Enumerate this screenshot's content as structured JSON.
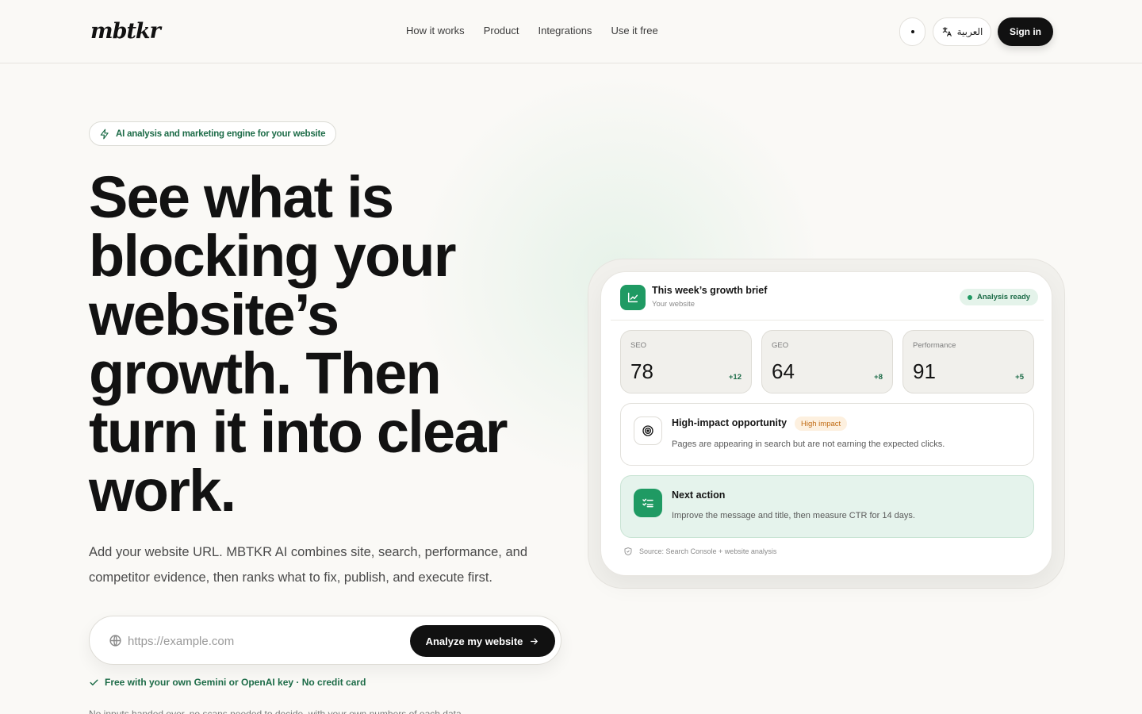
{
  "header": {
    "logo": "mbtkr",
    "nav": [
      "How it works",
      "Product",
      "Integrations",
      "Use it free"
    ],
    "language_label": "العربية",
    "signin_label": "Sign in"
  },
  "hero": {
    "badge": "AI analysis and marketing engine for your website",
    "headline": "See what is blocking your website’s growth. Then turn it into clear work.",
    "subtext": "Add your website URL. MBTKR AI combines site, search, performance, and competitor evidence, then ranks what to fix, publish, and execute first.",
    "url_placeholder": "https://example.com",
    "url_value": "",
    "cta_label": "Analyze my website",
    "free_note": "Free with your own Gemini or OpenAI key · No credit card",
    "cut_text": "No inputs handed over, no scans needed to decide, with your own numbers of each data"
  },
  "card": {
    "title": "This week’s growth brief",
    "subtitle": "Your website",
    "status": "Analysis ready",
    "metrics": [
      {
        "label": "SEO",
        "value": "78",
        "delta": "+12"
      },
      {
        "label": "GEO",
        "value": "64",
        "delta": "+8"
      },
      {
        "label": "Performance",
        "value": "91",
        "delta": "+5"
      }
    ],
    "opportunity": {
      "title": "High-impact opportunity",
      "badge": "High impact",
      "description": "Pages are appearing in search but are not earning the expected clicks."
    },
    "next_action": {
      "title": "Next action",
      "description": "Improve the message and title, then measure CTR for 14 days."
    },
    "source": "Source: Search Console + website analysis"
  },
  "colors": {
    "accent": "#1f9a63",
    "accent_text": "#1c6b47",
    "dark": "#111111",
    "background": "#faf9f6",
    "warning": "#c06a12"
  },
  "icons": [
    "bolt-icon",
    "translate-icon",
    "globe-icon",
    "arrow-right-icon",
    "check-icon",
    "chart-icon",
    "target-icon",
    "checklist-icon",
    "shield-icon"
  ]
}
